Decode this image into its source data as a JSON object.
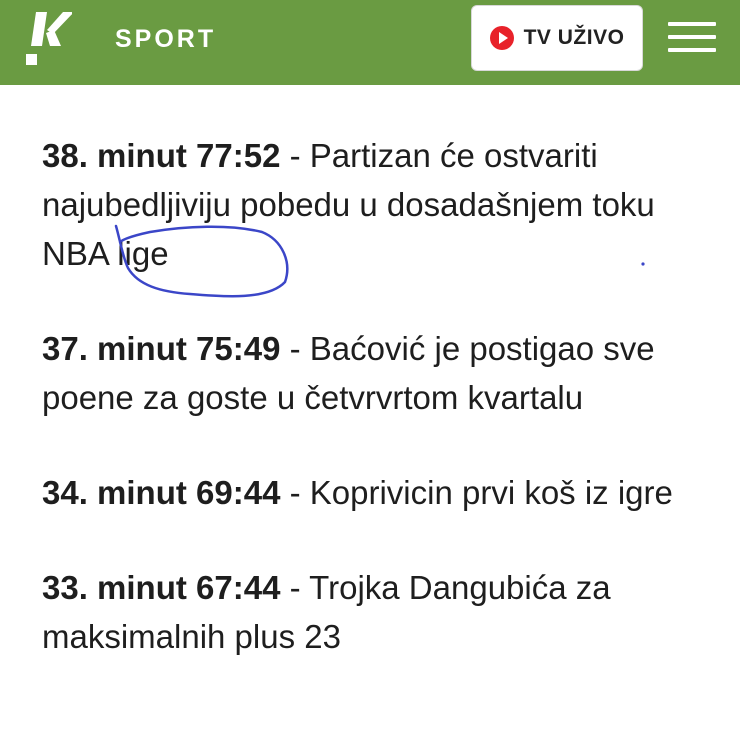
{
  "header": {
    "logo_letter": "K",
    "section": "SPORT",
    "tv_button_label": "TV UŽIVO",
    "icons": {
      "tv": "play-icon",
      "menu": "hamburger-menu-icon"
    },
    "colors": {
      "bar": "#6a9b42",
      "play": "#e8222a"
    }
  },
  "feed": [
    {
      "stamp": "38. minut 77:52",
      "separator": " - ",
      "text_before": "Partizan će ostvariti najubedljiviju pobedu u dosadašnjem toku ",
      "text_marked": "NBA lige"
    },
    {
      "stamp": "37. minut 75:49",
      "separator": " - ",
      "text": "Baćović je postigao sve poene za goste u četvrvrtom kvartalu"
    },
    {
      "stamp": "34. minut 69:44",
      "separator": " - ",
      "text": "Koprivicin prvi koš iz igre"
    },
    {
      "stamp": "33. minut 67:44",
      "separator": " - ",
      "text": "Trojka Dangubića za maksimalnih plus 23"
    }
  ],
  "annotation": {
    "color": "#3b46c8"
  }
}
